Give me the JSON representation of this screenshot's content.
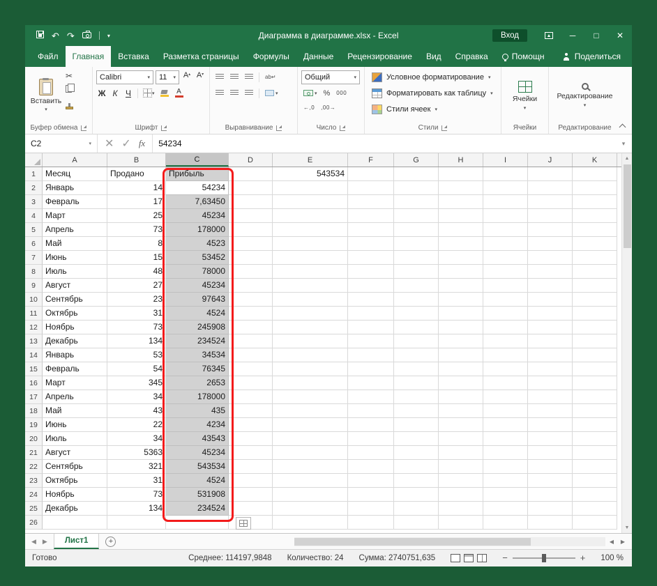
{
  "colors": {
    "excel_green": "#217346",
    "frame_green": "#1b5c36",
    "selection_gray": "#d2d2d2",
    "annotation_red": "#f31b1b"
  },
  "titlebar": {
    "title": "Диаграмма в диаграмме.xlsx - Excel",
    "signin_label": "Вход"
  },
  "ribbon_tabs": [
    {
      "key": "file",
      "label": "Файл"
    },
    {
      "key": "home",
      "label": "Главная",
      "active": true
    },
    {
      "key": "insert",
      "label": "Вставка"
    },
    {
      "key": "page-layout",
      "label": "Разметка страницы"
    },
    {
      "key": "formulas",
      "label": "Формулы"
    },
    {
      "key": "data",
      "label": "Данные"
    },
    {
      "key": "review",
      "label": "Рецензирование"
    },
    {
      "key": "view",
      "label": "Вид"
    },
    {
      "key": "help",
      "label": "Справка"
    },
    {
      "key": "assistant",
      "label": "Помощн",
      "icon": "bulb"
    }
  ],
  "share_label": "Поделиться",
  "ribbon": {
    "paste_label": "Вставить",
    "clipboard_group": "Буфер обмена",
    "font_name": "Calibri",
    "font_size": "11",
    "bold": "Ж",
    "italic": "К",
    "underline": "Ч",
    "font_group": "Шрифт",
    "alignment_group": "Выравнивание",
    "number_format": "Общий",
    "percent": "%",
    "thousands": "000",
    "number_group": "Число",
    "conditional_formatting": "Условное форматирование",
    "format_as_table": "Форматировать как таблицу",
    "cell_styles": "Стили ячеек",
    "styles_group": "Стили",
    "cells_group": "Ячейки",
    "editing_group": "Редактирование"
  },
  "formula_bar": {
    "name_box": "C2",
    "fx": "fx",
    "value": "54234"
  },
  "grid": {
    "col_headers": [
      "A",
      "B",
      "C",
      "D",
      "E",
      "F",
      "G",
      "H",
      "I",
      "J",
      "K"
    ],
    "selection": {
      "column": "C",
      "active": "C2",
      "rows_from": 1,
      "rows_to": 25
    },
    "rows": [
      {
        "n": 1,
        "cells": {
          "A": "Месяц",
          "B": "Продано",
          "C": "Прибыль",
          "E": "543534"
        }
      },
      {
        "n": 2,
        "cells": {
          "A": "Январь",
          "B": "14",
          "C": "54234"
        }
      },
      {
        "n": 3,
        "cells": {
          "A": "Февраль",
          "B": "17",
          "C": "7,63450"
        }
      },
      {
        "n": 4,
        "cells": {
          "A": "Март",
          "B": "25",
          "C": "45234"
        }
      },
      {
        "n": 5,
        "cells": {
          "A": "Апрель",
          "B": "73",
          "C": "178000"
        }
      },
      {
        "n": 6,
        "cells": {
          "A": "Май",
          "B": "8",
          "C": "4523"
        }
      },
      {
        "n": 7,
        "cells": {
          "A": "Июнь",
          "B": "15",
          "C": "53452"
        }
      },
      {
        "n": 8,
        "cells": {
          "A": "Июль",
          "B": "48",
          "C": "78000"
        }
      },
      {
        "n": 9,
        "cells": {
          "A": "Август",
          "B": "27",
          "C": "45234"
        }
      },
      {
        "n": 10,
        "cells": {
          "A": "Сентябрь",
          "B": "23",
          "C": "97643"
        }
      },
      {
        "n": 11,
        "cells": {
          "A": "Октябрь",
          "B": "31",
          "C": "4524"
        }
      },
      {
        "n": 12,
        "cells": {
          "A": "Ноябрь",
          "B": "73",
          "C": "245908"
        }
      },
      {
        "n": 13,
        "cells": {
          "A": "Декабрь",
          "B": "134",
          "C": "234524"
        }
      },
      {
        "n": 14,
        "cells": {
          "A": "Январь",
          "B": "53",
          "C": "34534"
        }
      },
      {
        "n": 15,
        "cells": {
          "A": "Февраль",
          "B": "54",
          "C": "76345"
        }
      },
      {
        "n": 16,
        "cells": {
          "A": "Март",
          "B": "345",
          "C": "2653"
        }
      },
      {
        "n": 17,
        "cells": {
          "A": "Апрель",
          "B": "34",
          "C": "178000"
        }
      },
      {
        "n": 18,
        "cells": {
          "A": "Май",
          "B": "43",
          "C": "435"
        }
      },
      {
        "n": 19,
        "cells": {
          "A": "Июнь",
          "B": "22",
          "C": "4234"
        }
      },
      {
        "n": 20,
        "cells": {
          "A": "Июль",
          "B": "34",
          "C": "43543"
        }
      },
      {
        "n": 21,
        "cells": {
          "A": "Август",
          "B": "5363",
          "C": "45234"
        }
      },
      {
        "n": 22,
        "cells": {
          "A": "Сентябрь",
          "B": "321",
          "C": "543534"
        }
      },
      {
        "n": 23,
        "cells": {
          "A": "Октябрь",
          "B": "31",
          "C": "4524"
        }
      },
      {
        "n": 24,
        "cells": {
          "A": "Ноябрь",
          "B": "73",
          "C": "531908"
        }
      },
      {
        "n": 25,
        "cells": {
          "A": "Декабрь",
          "B": "134",
          "C": "234524"
        }
      },
      {
        "n": 26,
        "cells": {}
      }
    ]
  },
  "sheet_tabs": {
    "active_sheet": "Лист1"
  },
  "status_bar": {
    "mode": "Готово",
    "average": "Среднее: 114197,9848",
    "count": "Количество: 24",
    "sum": "Сумма: 2740751,635",
    "zoom": "100 %"
  }
}
